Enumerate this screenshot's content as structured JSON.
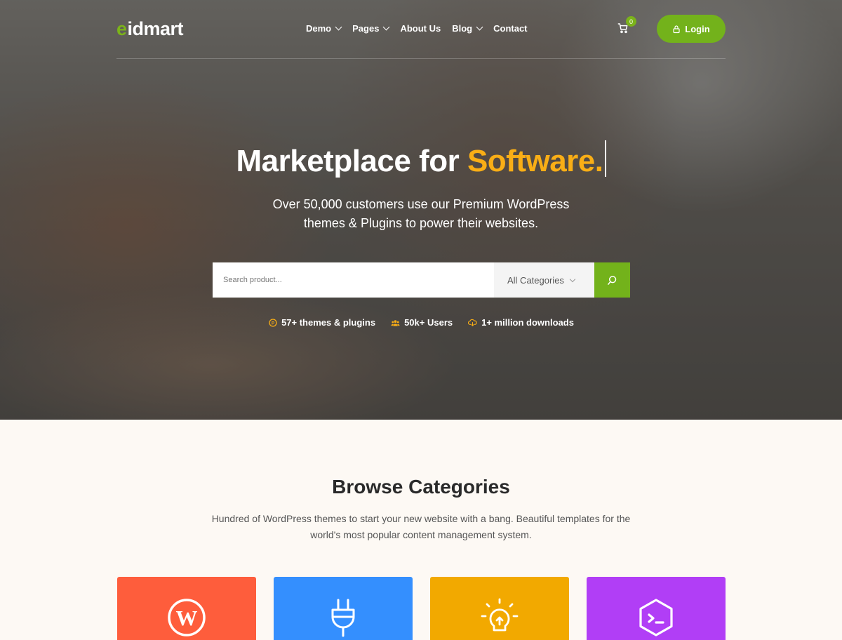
{
  "brand": {
    "logo_mark": "e",
    "logo_text": "idmart",
    "accent_color": "#73b21b",
    "highlight_color": "#f9ae16"
  },
  "nav": {
    "items": [
      {
        "label": "Demo",
        "has_dropdown": true
      },
      {
        "label": "Pages",
        "has_dropdown": true
      },
      {
        "label": "About Us",
        "has_dropdown": false
      },
      {
        "label": "Blog",
        "has_dropdown": true
      },
      {
        "label": "Contact",
        "has_dropdown": false
      }
    ],
    "cart_count": "0",
    "cart_icon": "cart-icon",
    "login_label": "Login",
    "login_icon": "lock-icon"
  },
  "hero": {
    "title_main": "Marketplace for ",
    "title_accent": "Software.",
    "subtitle": "Over 50,000 customers use our Premium WordPress themes & Plugins to power their websites.",
    "search_placeholder": "Search product...",
    "category_select": "All Categories",
    "search_icon": "search-icon",
    "stats": [
      {
        "icon": "p-coin-icon",
        "label": "57+ themes & plugins"
      },
      {
        "icon": "users-icon",
        "label": "50k+ Users"
      },
      {
        "icon": "cloud-download-icon",
        "label": "1+ million downloads"
      }
    ]
  },
  "categories": {
    "title": "Browse Categories",
    "description": "Hundred of WordPress themes to start your new website with a bang. Beautiful templates for the world's most popular content management system.",
    "cards": [
      {
        "icon": "wordpress-icon",
        "color": "#fe5d3c"
      },
      {
        "icon": "plug-icon",
        "color": "#348ffe"
      },
      {
        "icon": "lightbulb-icon",
        "color": "#f2a900"
      },
      {
        "icon": "terminal-icon",
        "color": "#b13ef6"
      }
    ]
  }
}
